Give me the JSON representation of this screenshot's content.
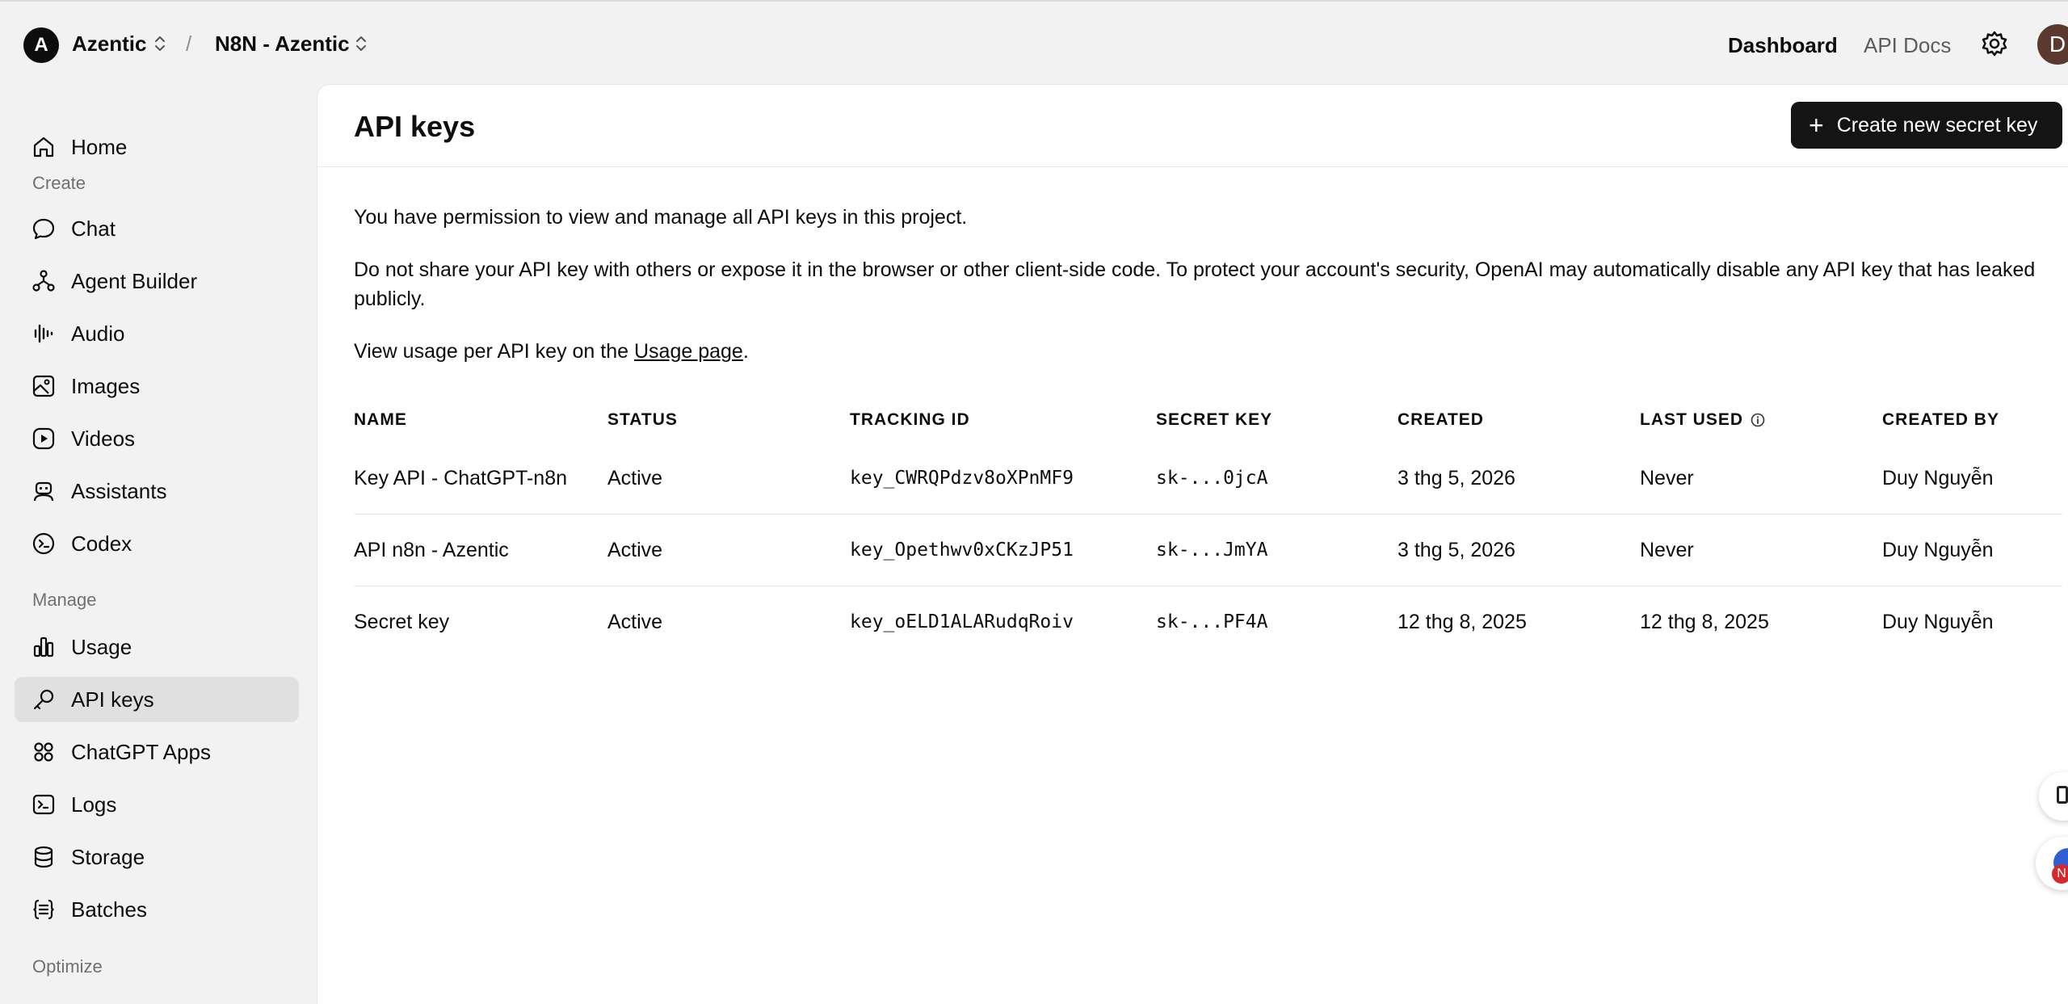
{
  "header": {
    "org_initial": "A",
    "org_name": "Azentic",
    "separator": "/",
    "project_name": "N8N - Azentic",
    "nav_dashboard": "Dashboard",
    "nav_api_docs": "API Docs",
    "user_initial": "D"
  },
  "sidebar": {
    "home": "Home",
    "section_create": "Create",
    "chat": "Chat",
    "agent_builder": "Agent Builder",
    "audio": "Audio",
    "images": "Images",
    "videos": "Videos",
    "assistants": "Assistants",
    "codex": "Codex",
    "section_manage": "Manage",
    "usage": "Usage",
    "api_keys": "API keys",
    "chatgpt_apps": "ChatGPT Apps",
    "logs": "Logs",
    "storage": "Storage",
    "batches": "Batches",
    "section_optimize": "Optimize"
  },
  "main": {
    "title": "API keys",
    "create_button": "Create new secret key",
    "create_button_icon": "+",
    "permission_text": "You have permission to view and manage all API keys in this project.",
    "warning_text": "Do not share your API key with others or expose it in the browser or other client-side code. To protect your account's security, OpenAI may automatically disable any API key that has leaked publicly.",
    "usage_prefix": "View usage per API key on the ",
    "usage_link": "Usage page",
    "usage_suffix": "."
  },
  "table": {
    "columns": [
      "NAME",
      "STATUS",
      "TRACKING ID",
      "SECRET KEY",
      "CREATED",
      "LAST USED",
      "CREATED BY"
    ],
    "rows": [
      {
        "name": "Key API - ChatGPT-n8n",
        "status": "Active",
        "tracking_id": "key_CWRQPdzv8oXPnMF9",
        "secret_key": "sk-...0jcA",
        "created": "3 thg 5, 2026",
        "last_used": "Never",
        "created_by": "Duy Nguyễn"
      },
      {
        "name": "API n8n - Azentic",
        "status": "Active",
        "tracking_id": "key_Opethwv0xCKzJP51",
        "secret_key": "sk-...JmYA",
        "created": "3 thg 5, 2026",
        "last_used": "Never",
        "created_by": "Duy Nguyễn"
      },
      {
        "name": "Secret key",
        "status": "Active",
        "tracking_id": "key_oELD1ALARudqRoiv",
        "secret_key": "sk-...PF4A",
        "created": "12 thg 8, 2025",
        "last_used": "12 thg 8, 2025",
        "created_by": "Duy Nguyễn"
      }
    ]
  },
  "floating": {
    "badge": "N"
  },
  "colors": {
    "background": "#f2f2f2",
    "panel": "#ffffff",
    "primary_button": "#141414",
    "active_nav": "#e0e0e0"
  }
}
